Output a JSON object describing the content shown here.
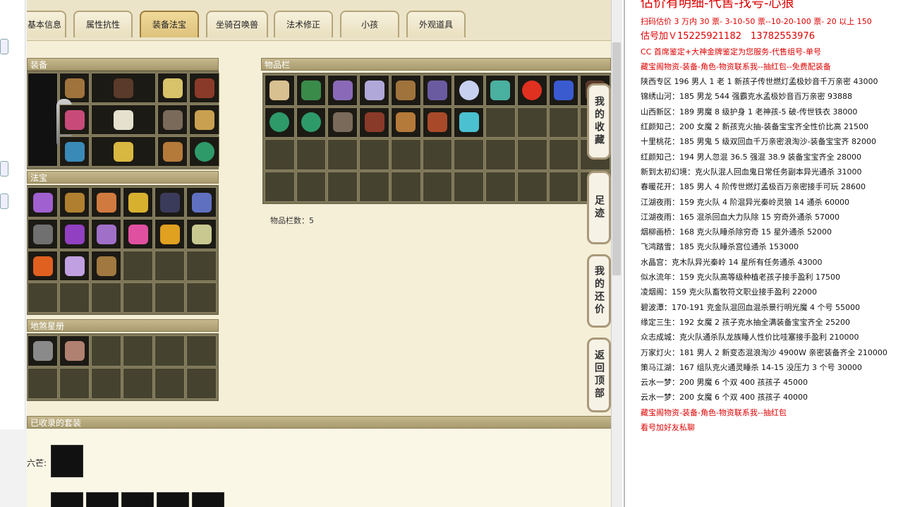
{
  "tabs": [
    "基本信息",
    "属性抗性",
    "装备法宝",
    "坐骑召唤兽",
    "法术修正",
    "小孩",
    "外观道具"
  ],
  "active_tab": "装备法宝",
  "equipment": {
    "title": "装备"
  },
  "magic": {
    "title": "法宝"
  },
  "star_book": {
    "title": "地煞星册"
  },
  "inventory": {
    "title": "物品栏",
    "count_label": "物品栏数：5"
  },
  "collected_sets": {
    "title": "已收录的套装",
    "set1_label": "六芒:"
  },
  "side_buttons": [
    "我的收藏",
    "足迹",
    "我的还价",
    "返回顶部"
  ],
  "right_panel": {
    "lines": [
      {
        "text": "估价有明细-代售-找号-心狼",
        "style": "big"
      },
      {
        "text": "扫码估价 3 万内 30 票- 3-10-50 票--10-20-100 票- 20 以上 150",
        "style": "red"
      },
      {
        "text": "估号加Ｖ15225921182　13782553976",
        "style": "mid"
      },
      {
        "text": "CC 首席鉴定+大神金牌鉴定为您服务-代售组号-单号",
        "style": "red"
      },
      {
        "text": "藏宝阁物资-装备-角色-物资联系我--抽红包--免费配装备",
        "style": "red"
      },
      {
        "text": "陕西专区 196 男人 1 老 1 新孩子传世燃灯孟极妙音千万亲密 43000",
        "style": ""
      },
      {
        "text": "锦绣山河：185 男龙 544 强霸克水孟极妙音百万亲密 93888",
        "style": ""
      },
      {
        "text": "山西新区：189 男魔 8 级护身 1 老神孩-5 破-传世铁衣 38000",
        "style": ""
      },
      {
        "text": "红颜知己：200 女魔 2 新孩克火抽-装备宝宝齐全性价比高 21500",
        "style": ""
      },
      {
        "text": "十里桃花：185 男鬼 5 级双回血千万亲密浪淘沙-装备宝宝齐 82000",
        "style": ""
      },
      {
        "text": "红颜知己：194 男人忽混 36.5 强混 38.9 装备宝宝齐全 28000",
        "style": ""
      },
      {
        "text": "新到太初幻境：克火队混人回血鬼日常任务副本异光通杀 31000",
        "style": ""
      },
      {
        "text": "春暖花开：185 男人 4 阶传世燃灯孟极百万亲密接手可玩 28600",
        "style": ""
      },
      {
        "text": "江湖夜雨：159 克火队 4 阶混异光秦岭灵狼 14 通杀 60000",
        "style": ""
      },
      {
        "text": "江湖夜雨：165 混杀回血大力队除 15 穷奇外通杀 57000",
        "style": ""
      },
      {
        "text": "烟柳画桥：168 克火队睡杀除穷奇 15 星外通杀 52000",
        "style": ""
      },
      {
        "text": "飞鸿踏雪：185 克火队睡杀宫位通杀 153000",
        "style": ""
      },
      {
        "text": "水晶宫：克木队异光秦岭 14 星所有任务通杀 43000",
        "style": ""
      },
      {
        "text": "似水流年：159 克火队高等级种植老孩子接手盈利 17500",
        "style": ""
      },
      {
        "text": "凌烟阁：159 克火队畜牧符文职业接手盈利 22000",
        "style": ""
      },
      {
        "text": "碧波潭：170-191 克金队混回血混杀景行明光魔 4 个号 55000",
        "style": ""
      },
      {
        "text": "缘定三生：192 女魔 2 孩子克水抽全满装备宝宝齐全 25200",
        "style": ""
      },
      {
        "text": "众志成城：克火队通杀队龙族睡人性价比哇塞接手盈利 210000",
        "style": ""
      },
      {
        "text": "万家灯火：181 男人 2 新变态混浪淘沙 4900W 亲密装备齐全 210000",
        "style": ""
      },
      {
        "text": "策马江湖：167 组队克火通灵睡杀 14-15 没压力 3 个号 30000",
        "style": ""
      },
      {
        "text": "云水一梦：200 男魔 6 个双 400 孩孩子 45000",
        "style": ""
      },
      {
        "text": "云水一梦：200 女魔 6 个双 400 孩孩子 40000",
        "style": ""
      },
      {
        "text": "藏宝阁物资-装备-角色-物资联系我--抽红包",
        "style": "red"
      },
      {
        "text": "看号加好友私聊",
        "style": "red"
      }
    ]
  },
  "colors": {
    "red_text": "#d00000",
    "active_tab": "#dec27c",
    "panel_bg": "#f5efd8"
  }
}
